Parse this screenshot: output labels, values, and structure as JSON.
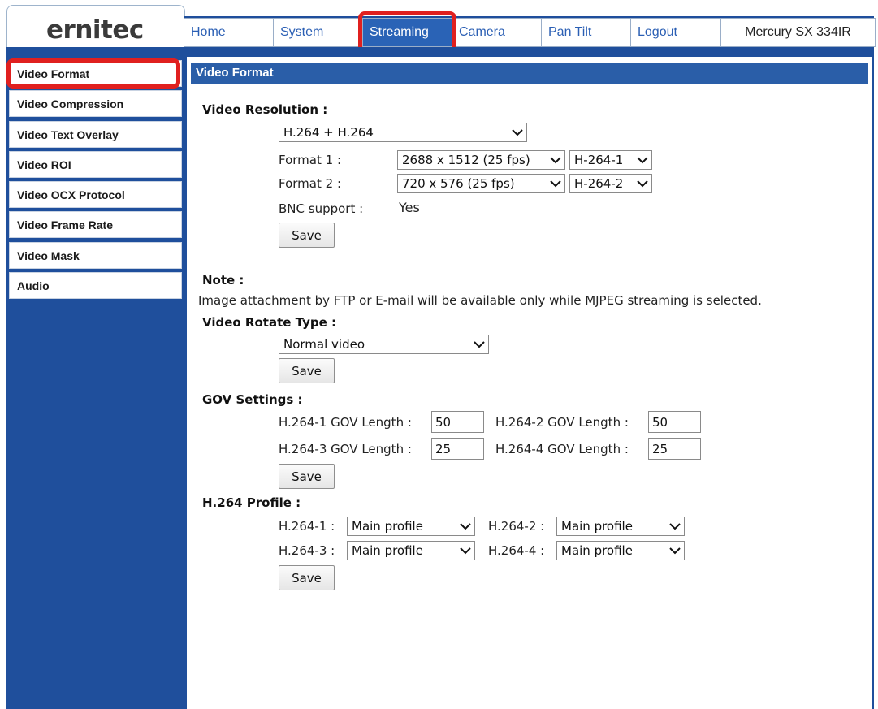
{
  "brand": {
    "logo": "ernitec"
  },
  "nav": {
    "items": [
      {
        "label": "Home"
      },
      {
        "label": "System"
      },
      {
        "label": "Streaming"
      },
      {
        "label": "Camera"
      },
      {
        "label": "Pan Tilt"
      },
      {
        "label": "Logout"
      }
    ],
    "model": "Mercury SX 334IR",
    "active": "Streaming"
  },
  "sidebar": {
    "items": [
      {
        "label": "Video Format"
      },
      {
        "label": "Video Compression"
      },
      {
        "label": "Video Text Overlay"
      },
      {
        "label": "Video ROI"
      },
      {
        "label": "Video OCX Protocol"
      },
      {
        "label": "Video Frame Rate"
      },
      {
        "label": "Video Mask"
      },
      {
        "label": "Audio"
      }
    ],
    "active": "Video Format"
  },
  "page": {
    "title": "Video Format"
  },
  "video_resolution": {
    "heading": "Video Resolution :",
    "mode": "H.264 + H.264",
    "format1_label": "Format 1 :",
    "format1_resolution": "2688 x 1512 (25 fps)",
    "format1_stream": "H-264-1",
    "format2_label": "Format 2 :",
    "format2_resolution": "720 x 576 (25 fps)",
    "format2_stream": "H-264-2",
    "bnc_label": "BNC support :",
    "bnc_value": "Yes",
    "save": "Save"
  },
  "note": {
    "heading": "Note :",
    "text": "Image attachment by FTP or E-mail will be available only while MJPEG streaming is selected."
  },
  "rotate": {
    "heading": "Video Rotate Type :",
    "value": "Normal video",
    "save": "Save"
  },
  "gov": {
    "heading": "GOV Settings :",
    "h1_label": "H.264-1 GOV Length :",
    "h1_value": "50",
    "h2_label": "H.264-2 GOV Length :",
    "h2_value": "50",
    "h3_label": "H.264-3 GOV Length :",
    "h3_value": "25",
    "h4_label": "H.264-4 GOV Length :",
    "h4_value": "25",
    "save": "Save"
  },
  "profile": {
    "heading": "H.264 Profile :",
    "p1_label": "H.264-1 :",
    "p1_value": "Main profile",
    "p2_label": "H.264-2 :",
    "p2_value": "Main profile",
    "p3_label": "H.264-3 :",
    "p3_value": "Main profile",
    "p4_label": "H.264-4 :",
    "p4_value": "Main profile",
    "save": "Save"
  },
  "colors": {
    "nav_blue": "#1f4f9c",
    "active_blue": "#2a63b6",
    "highlight_red": "#e0201f"
  }
}
